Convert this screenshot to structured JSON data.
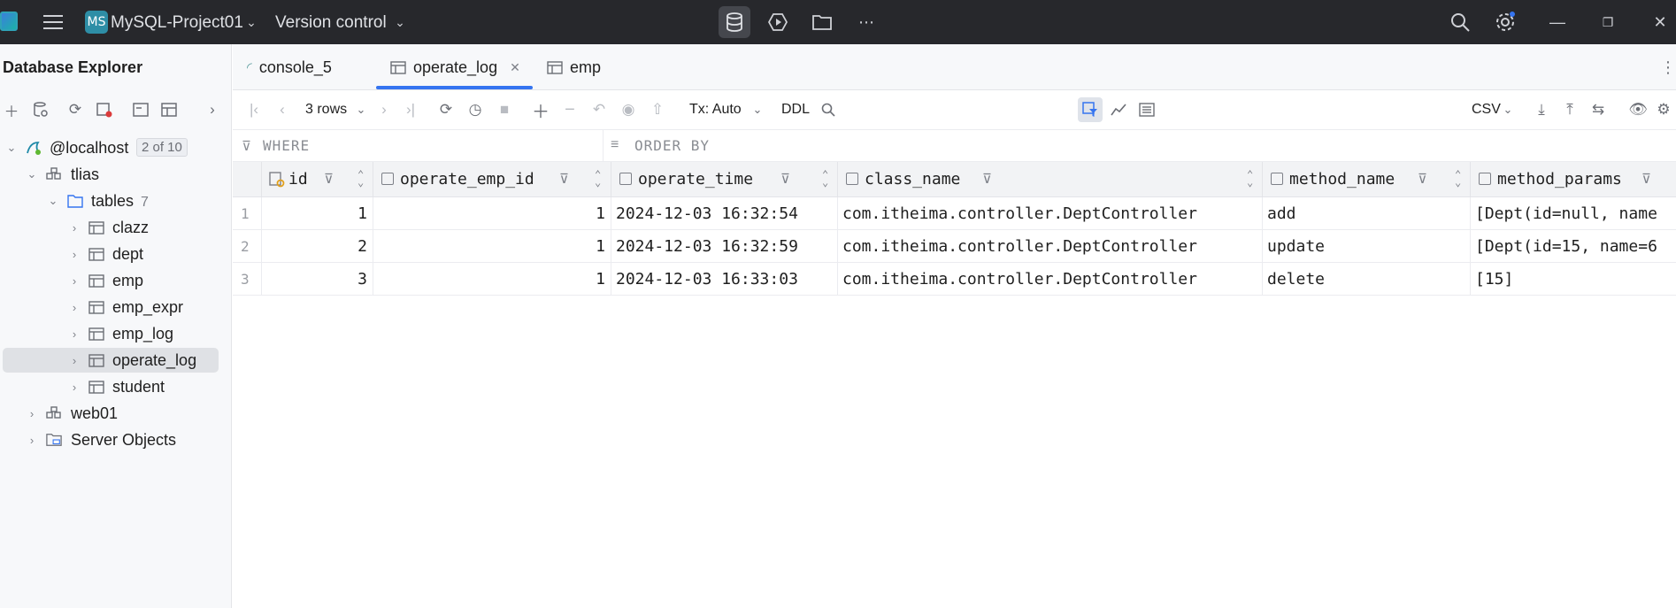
{
  "titlebar": {
    "project_badge": "MS",
    "project_name": "MySQL-Project01",
    "vcs": "Version control"
  },
  "sidebar": {
    "title": "Database Explorer",
    "tree": {
      "host": "@localhost",
      "host_count": "2 of 10",
      "schema1": "tlias",
      "tables_folder": "tables",
      "tables_count": "7",
      "tables": [
        "clazz",
        "dept",
        "emp",
        "emp_expr",
        "emp_log",
        "operate_log",
        "student"
      ],
      "schema2": "web01",
      "server_objects": "Server Objects"
    }
  },
  "tabs": [
    {
      "label": "console_5"
    },
    {
      "label": "operate_log"
    },
    {
      "label": "emp"
    }
  ],
  "toolbar": {
    "rows": "3 rows",
    "tx": "Tx: Auto",
    "ddl": "DDL",
    "export_format": "CSV"
  },
  "filters": {
    "where": "WHERE",
    "order_by": "ORDER BY"
  },
  "table": {
    "columns": [
      "id",
      "operate_emp_id",
      "operate_time",
      "class_name",
      "method_name",
      "method_params"
    ],
    "rows": [
      {
        "n": "1",
        "id": "1",
        "operate_emp_id": "1",
        "operate_time": "2024-12-03 16:32:54",
        "class_name": "com.itheima.controller.DeptController",
        "method_name": "add",
        "method_params": "[Dept(id=null, name"
      },
      {
        "n": "2",
        "id": "2",
        "operate_emp_id": "1",
        "operate_time": "2024-12-03 16:32:59",
        "class_name": "com.itheima.controller.DeptController",
        "method_name": "update",
        "method_params": "[Dept(id=15, name=6"
      },
      {
        "n": "3",
        "id": "3",
        "operate_emp_id": "1",
        "operate_time": "2024-12-03 16:33:03",
        "class_name": "com.itheima.controller.DeptController",
        "method_name": "delete",
        "method_params": "[15]"
      }
    ]
  },
  "colors": {
    "accent": "#3574f0",
    "titlebar_bg": "#27282c"
  }
}
